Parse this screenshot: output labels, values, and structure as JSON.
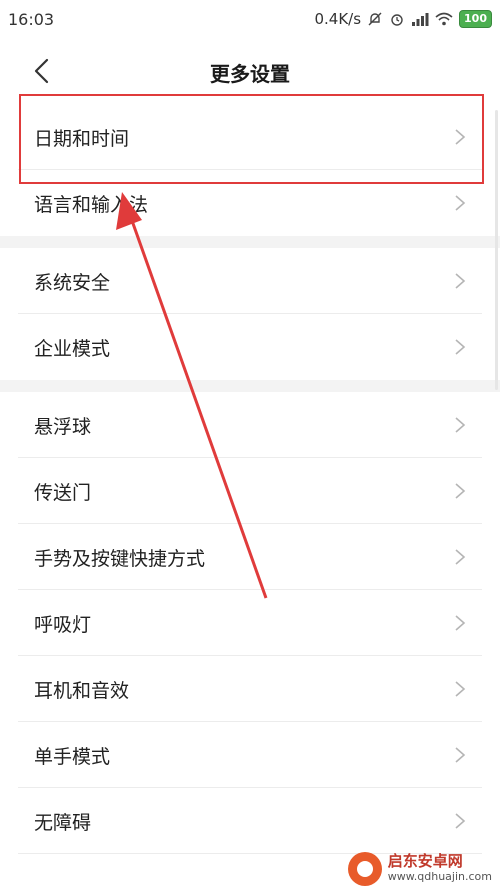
{
  "status_bar": {
    "time": "16:03",
    "speed": "0.4K/s",
    "battery": "100"
  },
  "header": {
    "title": "更多设置"
  },
  "groups": [
    {
      "items": [
        {
          "label": "日期和时间"
        },
        {
          "label": "语言和输入法"
        }
      ]
    },
    {
      "items": [
        {
          "label": "系统安全"
        },
        {
          "label": "企业模式"
        }
      ]
    },
    {
      "items": [
        {
          "label": "悬浮球"
        },
        {
          "label": "传送门"
        },
        {
          "label": "手势及按键快捷方式"
        },
        {
          "label": "呼吸灯"
        },
        {
          "label": "耳机和音效"
        },
        {
          "label": "单手模式"
        },
        {
          "label": "无障碍"
        }
      ]
    }
  ],
  "watermark": {
    "name": "启东安卓网",
    "url": "www.qdhuajin.com"
  },
  "colors": {
    "annotation": "#e03b3b",
    "battery": "#4caf50"
  }
}
